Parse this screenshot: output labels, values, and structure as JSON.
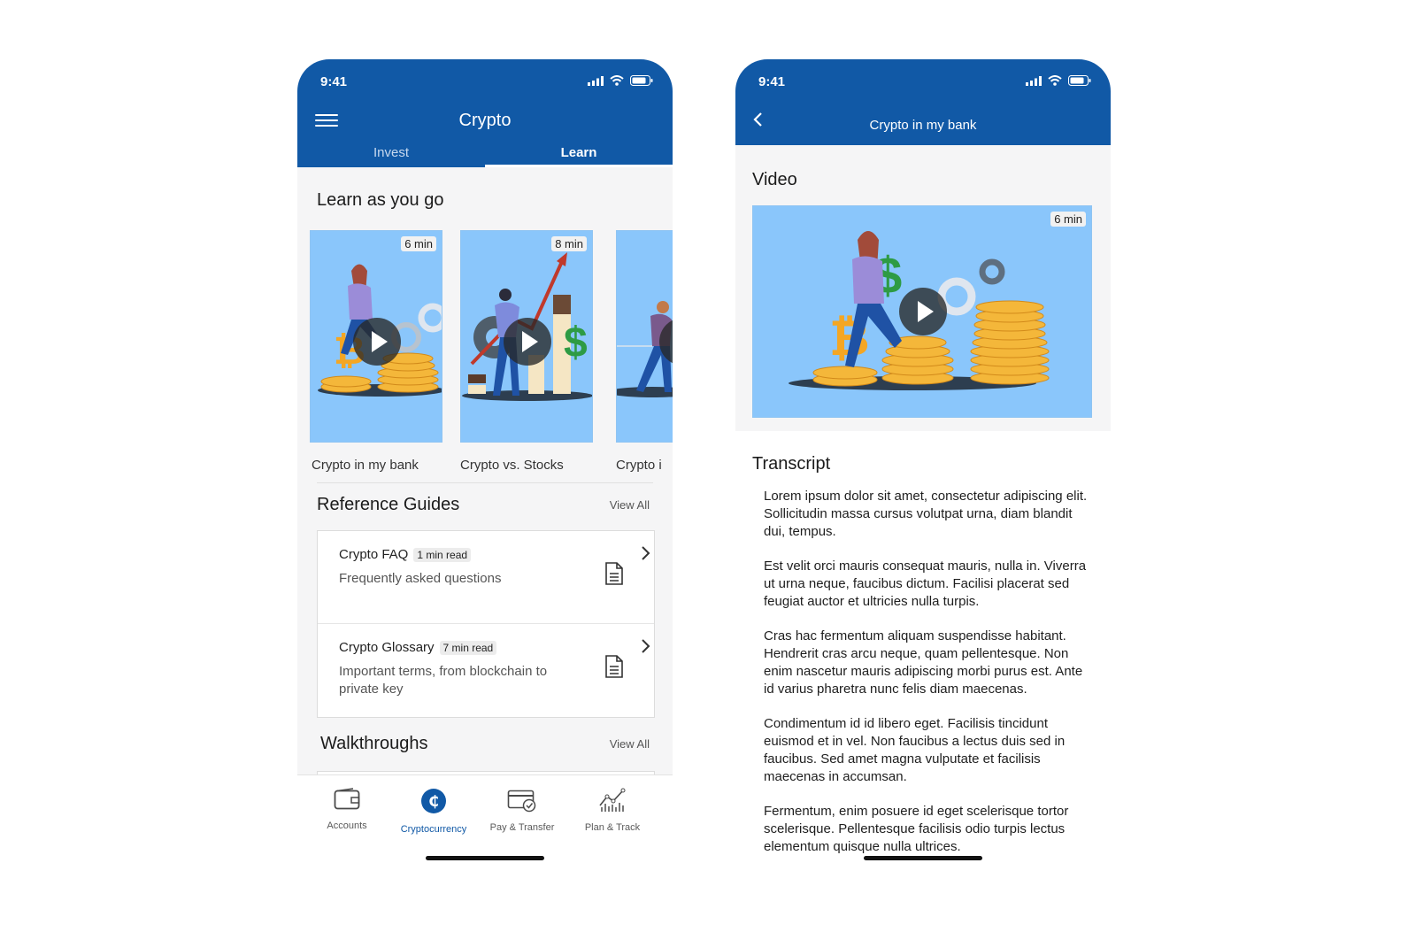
{
  "learn_screen": {
    "status": {
      "time": "9:41"
    },
    "header": {
      "title": "Crypto",
      "tabs": [
        "Invest",
        "Learn"
      ],
      "active_tab": "Learn"
    },
    "learn_section": {
      "title": "Learn as you go",
      "cards": [
        {
          "label": "Crypto in my bank",
          "duration": "6 min"
        },
        {
          "label": "Crypto vs. Stocks",
          "duration": "8 min"
        },
        {
          "label": "Crypto i",
          "duration": ""
        }
      ]
    },
    "reference_guides": {
      "title": "Reference Guides",
      "view_all": "View All",
      "items": [
        {
          "name": "Crypto FAQ",
          "badge": "1 min read",
          "desc": "Frequently asked questions"
        },
        {
          "name": "Crypto Glossary",
          "badge": "7 min read",
          "desc": "Important terms, from blockchain to private key"
        }
      ]
    },
    "walkthroughs": {
      "title": "Walkthroughs",
      "view_all": "View All"
    },
    "tabbar": [
      {
        "label": "Accounts",
        "icon": "wallet-icon"
      },
      {
        "label": "Cryptocurrency",
        "icon": "crypto-coin-icon",
        "active": true
      },
      {
        "label": "Pay & Transfer",
        "icon": "pay-transfer-icon"
      },
      {
        "label": "Plan & Track",
        "icon": "chart-icon"
      }
    ]
  },
  "video_screen": {
    "status": {
      "time": "9:41"
    },
    "header": {
      "title": "Crypto in my bank"
    },
    "video_section": {
      "title": "Video",
      "duration": "6 min"
    },
    "transcript": {
      "title": "Transcript",
      "paragraphs": [
        "Lorem ipsum dolor sit amet, consectetur adipiscing elit. Sollicitudin massa cursus volutpat urna, diam blandit dui, tempus.",
        "Est velit orci mauris consequat mauris, nulla in. Viverra ut urna neque, faucibus dictum. Facilisi placerat sed feugiat auctor et ultricies nulla turpis.",
        "Cras hac fermentum aliquam suspendisse habitant. Hendrerit cras arcu neque, quam pellentesque. Non enim nascetur mauris adipiscing morbi purus est. Ante id varius pharetra nunc felis diam maecenas.",
        "Condimentum id id libero eget. Facilisis tincidunt euismod et in vel. Non faucibus a lectus duis sed in faucibus. Sed amet magna vulputate et facilisis maecenas in accumsan.",
        "Fermentum, enim posuere id eget scelerisque tortor scelerisque. Pellentesque facilisis odio turpis lectus elementum quisque nulla ultrices."
      ]
    }
  },
  "colors": {
    "brand_blue": "#1159a6",
    "card_blue": "#8ac6fb",
    "coin_gold": "#f4b73a"
  }
}
